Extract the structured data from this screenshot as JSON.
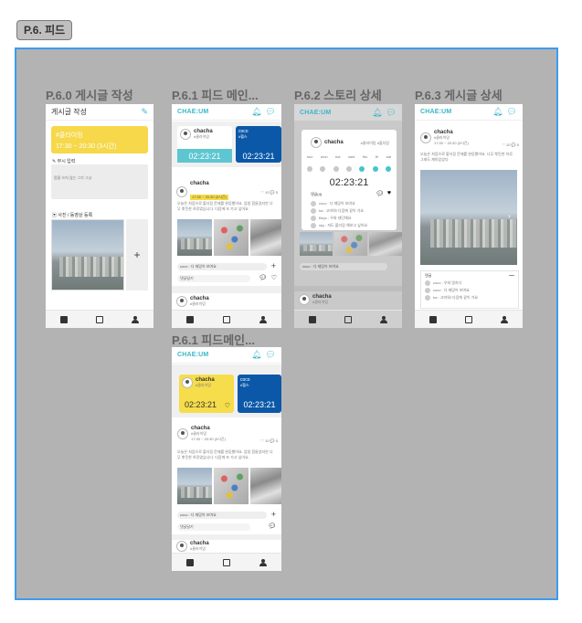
{
  "section_tag": "P.6. 피드",
  "frames": {
    "write": {
      "label": "P.6.0 게시글 작성"
    },
    "feed_main": {
      "label": "P.6.1 피드 메인..."
    },
    "story_detail": {
      "label": "P.6.2 스토리 상세"
    },
    "post_detail": {
      "label": "P.6.3 게시글 상세"
    },
    "feed_main_2": {
      "label": "P.6.1 피드메인..."
    }
  },
  "app": {
    "brand": "CHAE:UM"
  },
  "write": {
    "title": "게시글 작성",
    "place": "#클라이밍",
    "time": "17:30 ~ 20:30 (3시간)",
    "text_section": "무시 입력",
    "text_placeholder": "몸을 쓰지 않는 그가 그냥",
    "photo_section": "사진 / 동영상 등록",
    "add_symbol": "+"
  },
  "feed": {
    "story1": {
      "name": "chacha",
      "tag": "#클라이밍",
      "timer": "02:23:21"
    },
    "story2": {
      "name": "coco",
      "tag": "#헬스",
      "timer": "02:23:21"
    },
    "post": {
      "name": "chacha",
      "tag": "#클라이밍",
      "time": "17:30 ~ 20:30 (3시간)",
      "counts": "♡ 10  💬 5",
      "body": "오늘은 처음으로 볼더링 문제를 완등했어요. 엄청 힘들었지만 너무 뿌듯한 하루였습니다. 다음에 또 가고 싶어요.",
      "comment_preview": "coco : 다 재밌어 보여요",
      "comment_input": "댓글달기"
    },
    "post2_name": "chacha",
    "post2_tag": "#클라이밍"
  },
  "story_detail": {
    "name": "chacha",
    "tag": "#클라이밍 #볼더링",
    "days": [
      "sun",
      "mon",
      "tue",
      "wed",
      "thu",
      "fri",
      "sat"
    ],
    "timer": "02:23:21",
    "comments_title": "댓글(4)",
    "comments": [
      "coco : 다 재밌어 보여요",
      "ha : 고마워! 다음에 같이 가요",
      "Beyc : 우와 대단해요",
      "sky : 저도 볼더링 해보고 싶어요"
    ]
  },
  "post_detail": {
    "name": "chacha",
    "tag": "#클라이밍",
    "time": "17:30 ~ 20:30 (3시간)",
    "counts": "♡ 20  💬 5",
    "body": "오늘은 처음으로 볼더링 문제를 완등했어요. 너무 뿌듯한 하루. 그래도 재미있었다.",
    "comments_title": "댓글",
    "comments": [
      "coco : 우와 멋지다",
      "coco : 다 재밌어 보여요",
      "ha : 고마워! 다음에 같이 가요"
    ]
  }
}
